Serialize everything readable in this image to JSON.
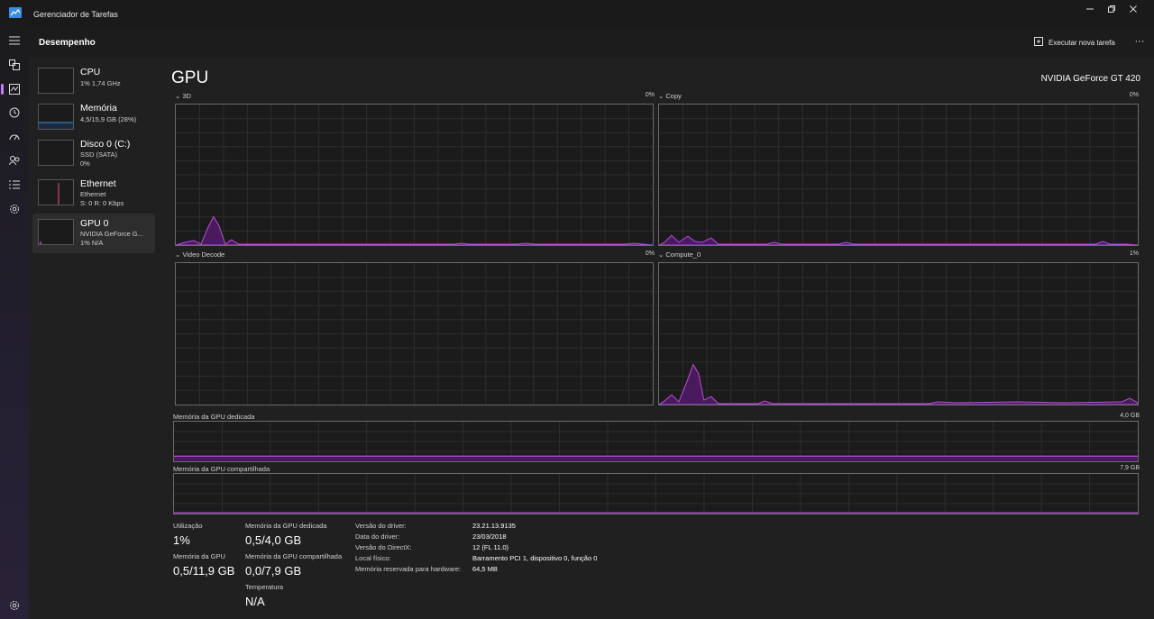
{
  "window": {
    "title": "Gerenciador de Tarefas"
  },
  "rail": {
    "icons": [
      "hamburger-icon",
      "processes-icon",
      "performance-icon",
      "app-history-icon",
      "startup-apps-icon",
      "users-icon",
      "details-icon",
      "services-icon",
      "settings-icon"
    ]
  },
  "header": {
    "title": "Desempenho",
    "run_task_label": "Executar nova tarefa",
    "more_label": "···"
  },
  "sidebar": {
    "items": [
      {
        "name": "CPU",
        "line1": "1%  1,74 GHz",
        "line2": ""
      },
      {
        "name": "Memória",
        "line1": "4,5/15,9 GB (28%)",
        "line2": ""
      },
      {
        "name": "Disco 0 (C:)",
        "line1": "SSD (SATA)",
        "line2": "0%"
      },
      {
        "name": "Ethernet",
        "line1": "Ethernet",
        "line2": "S: 0 R: 0 Kbps"
      },
      {
        "name": "GPU 0",
        "line1": "NVIDIA GeForce G...",
        "line2": "1%  N/A"
      }
    ]
  },
  "main": {
    "title": "GPU",
    "model": "NVIDIA GeForce GT 420",
    "engines": [
      {
        "label": "3D",
        "pct": "0%"
      },
      {
        "label": "Copy",
        "pct": "0%"
      },
      {
        "label": "Video Decode",
        "pct": "0%"
      },
      {
        "label": "Compute_0",
        "pct": "1%"
      }
    ],
    "dedicated": {
      "label": "Memória da GPU dedicada",
      "max": "4,0 GB"
    },
    "shared": {
      "label": "Memória da GPU compartilhada",
      "max": "7,9 GB"
    },
    "stats": {
      "util_label": "Utilização",
      "util_value": "1%",
      "gpu_mem_label": "Memória da GPU",
      "gpu_mem_value": "0,5/11,9 GB",
      "ded_label": "Memória da GPU dedicada",
      "ded_value": "0,5/4,0 GB",
      "shared_label": "Memória da GPU compartilhada",
      "shared_value": "0,0/7,9 GB",
      "temp_label": "Temperatura",
      "temp_value": "N/A"
    },
    "info": [
      {
        "key": "Versão do driver:",
        "value": "23.21.13.9135"
      },
      {
        "key": "Data do driver:",
        "value": "23/03/2018"
      },
      {
        "key": "Versão do DirectX:",
        "value": "12 (FL 11.0)"
      },
      {
        "key": "Local físico:",
        "value": "Barramento PCI 1, dispositivo 0, função 0"
      },
      {
        "key": "Memória reservada para hardware:",
        "value": "64,5 MB"
      }
    ]
  },
  "colors": {
    "accent": "#c77dff",
    "graph_fill": "#4a1a5e",
    "graph_line": "#b84fd6",
    "grid": "#2e2e2e"
  }
}
